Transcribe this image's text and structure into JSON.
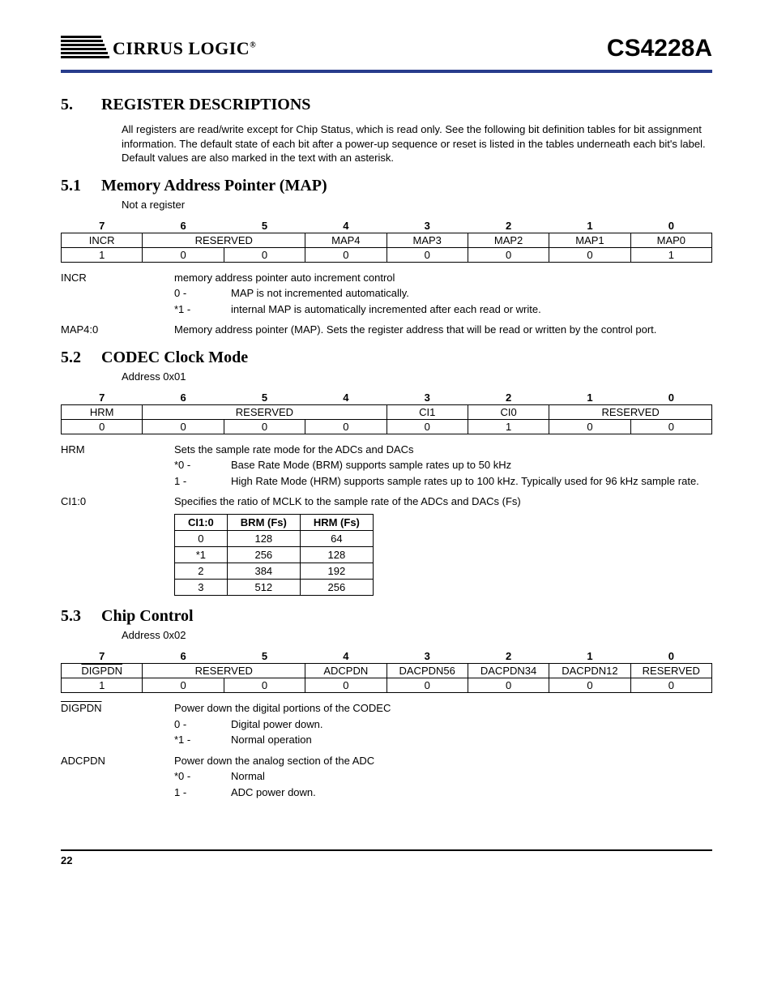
{
  "header": {
    "company": "CIRRUS LOGIC",
    "part": "CS4228A"
  },
  "section5": {
    "num": "5.",
    "title": "REGISTER DESCRIPTIONS",
    "intro": "All registers are read/write except for Chip Status, which is read only. See the following bit definition tables for bit assignment information. The default state of each bit after a power-up sequence or reset is listed in the tables underneath each bit's label. Default values are also marked in the text with an asterisk."
  },
  "s51": {
    "num": "5.1",
    "title": "Memory Address Pointer  (MAP)",
    "note": "Not a register",
    "bits_header": [
      "7",
      "6",
      "5",
      "4",
      "3",
      "2",
      "1",
      "0"
    ],
    "row1": [
      "INCR",
      "RESERVED",
      "",
      "MAP4",
      "MAP3",
      "MAP2",
      "MAP1",
      "MAP0"
    ],
    "row2": [
      "1",
      "0",
      "0",
      "0",
      "0",
      "0",
      "0",
      "1"
    ],
    "incr_label": "INCR",
    "incr_desc": "memory address pointer auto increment control",
    "incr_0k": "0 -",
    "incr_0v": "MAP is not incremented automatically.",
    "incr_1k": "*1 -",
    "incr_1v": "internal MAP is automatically incremented after each read or write.",
    "map_label": "MAP4:0",
    "map_desc": "Memory address pointer (MAP). Sets the register address that will be read or written by the control port."
  },
  "s52": {
    "num": "5.2",
    "title": "CODEC Clock Mode",
    "addr": "Address 0x01",
    "bits_header": [
      "7",
      "6",
      "5",
      "4",
      "3",
      "2",
      "1",
      "0"
    ],
    "row1": [
      "HRM",
      "RESERVED",
      "",
      "",
      "CI1",
      "CI0",
      "RESERVED",
      ""
    ],
    "row2": [
      "0",
      "0",
      "0",
      "0",
      "0",
      "1",
      "0",
      "0"
    ],
    "hrm_label": "HRM",
    "hrm_desc": "Sets the sample rate mode for the ADCs and DACs",
    "hrm_0k": "*0 -",
    "hrm_0v": "Base Rate Mode (BRM) supports sample rates up to 50 kHz",
    "hrm_1k": "1 -",
    "hrm_1v": "High Rate Mode (HRM) supports sample rates up to 100 kHz. Typically used for 96 kHz sample rate.",
    "ci_label": "CI1:0",
    "ci_desc": "Specifies the ratio of MCLK to the sample rate of the ADCs and DACs (Fs)",
    "tbl_h": [
      "CI1:0",
      "BRM (Fs)",
      "HRM (Fs)"
    ],
    "tbl_r0": [
      "0",
      "128",
      "64"
    ],
    "tbl_r1": [
      "*1",
      "256",
      "128"
    ],
    "tbl_r2": [
      "2",
      "384",
      "192"
    ],
    "tbl_r3": [
      "3",
      "512",
      "256"
    ]
  },
  "s53": {
    "num": "5.3",
    "title": "Chip Control",
    "addr": "Address 0x02",
    "bits_header": [
      "7",
      "6",
      "5",
      "4",
      "3",
      "2",
      "1",
      "0"
    ],
    "row1": [
      "DIGPDN",
      "RESERVED",
      "",
      "ADCPDN",
      "DACPDN56",
      "DACPDN34",
      "DACPDN12",
      "RESERVED"
    ],
    "row2": [
      "1",
      "0",
      "0",
      "0",
      "0",
      "0",
      "0",
      "0"
    ],
    "dig_label": "DIGPDN",
    "dig_desc": "Power down the digital portions of the CODEC",
    "dig_0k": "0 -",
    "dig_0v": "Digital power down.",
    "dig_1k": "*1 -",
    "dig_1v": "Normal operation",
    "adc_label": "ADCPDN",
    "adc_desc": "Power down the analog section of the ADC",
    "adc_0k": "*0 -",
    "adc_0v": "Normal",
    "adc_1k": "1 -",
    "adc_1v": "ADC power down."
  },
  "footer": {
    "page": "22"
  }
}
